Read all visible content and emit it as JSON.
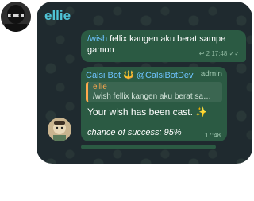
{
  "title": "ellie",
  "outgoing": {
    "command": "/wish",
    "text": " fellix kangen aku berat sampe gamon",
    "meta": "↩ 2 17:48 ✓✓"
  },
  "incoming": {
    "sender": "Calsi Bot 🔱 @CalsiBotDev",
    "role": "admin",
    "reply_name": "ellie",
    "reply_text": "/wish fellix kangen aku berat samp...",
    "wish_text": "Your wish has been cast.",
    "sparkle": "✨",
    "chance_text": "chance of success: 95%",
    "time": "17:48"
  },
  "colors": {
    "title": "#4fc3d7",
    "bubble": "#2b5a43",
    "link": "#6ec4ff",
    "reply_bar": "#ffa94d"
  }
}
